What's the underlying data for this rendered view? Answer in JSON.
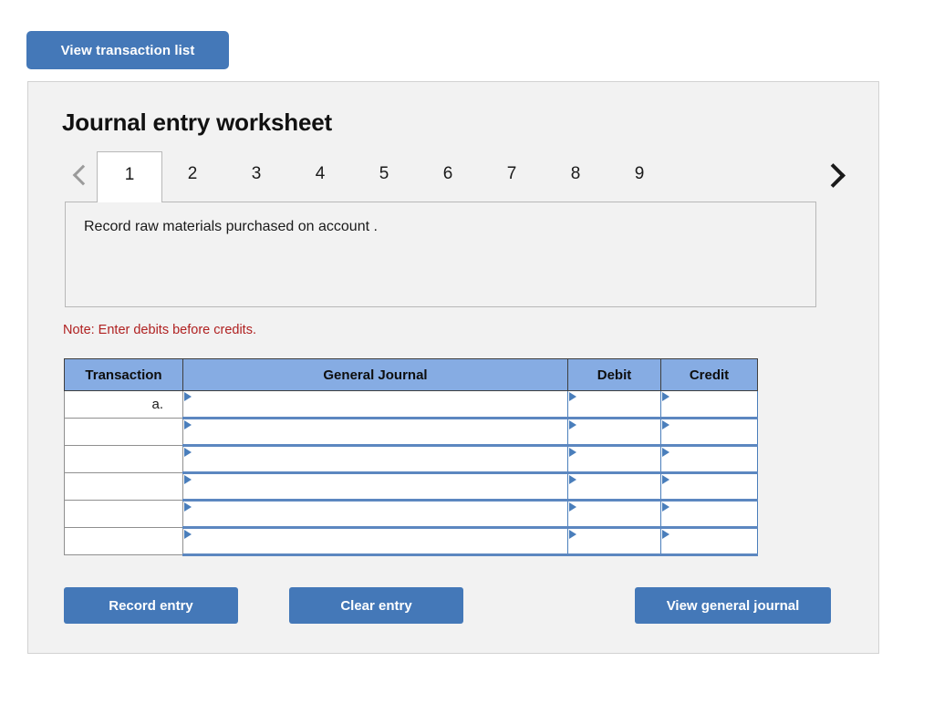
{
  "top_bar": {
    "view_transaction_list_label": "View transaction list"
  },
  "worksheet": {
    "title": "Journal entry worksheet",
    "tabs": [
      {
        "label": "1",
        "active": true
      },
      {
        "label": "2",
        "active": false
      },
      {
        "label": "3",
        "active": false
      },
      {
        "label": "4",
        "active": false
      },
      {
        "label": "5",
        "active": false
      },
      {
        "label": "6",
        "active": false
      },
      {
        "label": "7",
        "active": false
      },
      {
        "label": "8",
        "active": false
      },
      {
        "label": "9",
        "active": false
      }
    ],
    "prev_arrow": "‹",
    "next_arrow": "›",
    "description": "Record raw materials purchased on account .",
    "note": "Note: Enter debits before credits."
  },
  "table": {
    "headers": [
      "Transaction",
      "General Journal",
      "Debit",
      "Credit"
    ],
    "rows": [
      {
        "transaction": "a.",
        "general_journal": "",
        "debit": "",
        "credit": ""
      },
      {
        "transaction": "",
        "general_journal": "",
        "debit": "",
        "credit": ""
      },
      {
        "transaction": "",
        "general_journal": "",
        "debit": "",
        "credit": ""
      },
      {
        "transaction": "",
        "general_journal": "",
        "debit": "",
        "credit": ""
      },
      {
        "transaction": "",
        "general_journal": "",
        "debit": "",
        "credit": ""
      },
      {
        "transaction": "",
        "general_journal": "",
        "debit": "",
        "credit": ""
      }
    ]
  },
  "actions": {
    "record_entry_label": "Record entry",
    "clear_entry_label": "Clear entry",
    "view_general_journal_label": "View general journal"
  },
  "colors": {
    "button_blue": "#4478b8",
    "header_blue": "#86ace3",
    "select_border_blue": "#4a7ebb",
    "note_red": "#b02121",
    "panel_bg": "#f2f2f2"
  }
}
